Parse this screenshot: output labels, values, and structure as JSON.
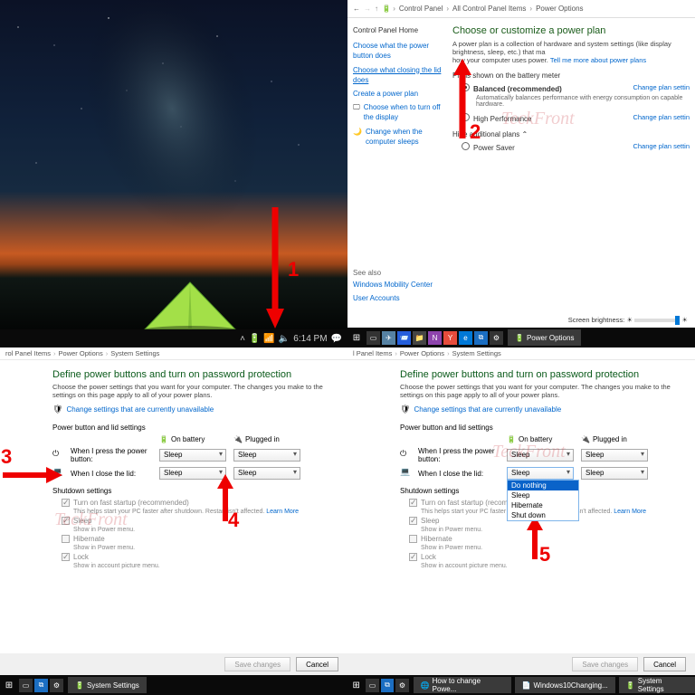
{
  "watermark": "TeckFront",
  "panel1": {
    "time": "6:14 PM",
    "arrow_label": "1"
  },
  "panel2": {
    "breadcrumb": [
      "Control Panel",
      "All Control Panel Items",
      "Power Options"
    ],
    "side_header": "Control Panel Home",
    "side_links": {
      "l1": "Choose what the power button does",
      "l2": "Choose what closing the lid does",
      "l3": "Create a power plan",
      "l4": "Choose when to turn off the display",
      "l5": "Change when the computer sleeps"
    },
    "title": "Choose or customize a power plan",
    "desc_a": "A power plan is a collection of hardware and system settings (like display brightness, sleep, etc.) that ma",
    "desc_b": "how your computer uses power. ",
    "desc_link": "Tell me more about power plans",
    "plans_label": "Plans shown on the battery meter",
    "plan_bal": "Balanced (recommended)",
    "plan_bal_sub": "Automatically balances performance with energy consumption on capable hardware.",
    "plan_hp": "High Performance",
    "hide_label": "Hide additional plans",
    "plan_ps": "Power Saver",
    "change_link": "Change plan settin",
    "seealso": "See also",
    "seealso_l1": "Windows Mobility Center",
    "seealso_l2": "User Accounts",
    "bright_label": "Screen brightness:",
    "taskbar_btn": "Power Options",
    "arrow_label": "2"
  },
  "panel3": {
    "breadcrumb": [
      "rol Panel Items",
      "Power Options",
      "System Settings"
    ],
    "title": "Define power buttons and turn on password protection",
    "desc": "Choose the power settings that you want for your computer. The changes you make to the settings on this page apply to all of your power plans.",
    "shield_link": "Change settings that are currently unavailable",
    "sec_label": "Power button and lid settings",
    "col_bat": "On battery",
    "col_plug": "Plugged in",
    "row1_label": "When I press the power button:",
    "row2_label": "When I close the lid:",
    "dd_value": "Sleep",
    "shut_label": "Shutdown settings",
    "opt_fast": "Turn on fast startup (recommended)",
    "opt_fast_sub_a": "This helps start your PC faster after shutdown. Restart isn't affected. ",
    "opt_fast_link": "Learn More",
    "opt_sleep": "Sleep",
    "opt_sleep_sub": "Show in Power menu.",
    "opt_hib": "Hibernate",
    "opt_hib_sub": "Show in Power menu.",
    "opt_lock": "Lock",
    "opt_lock_sub": "Show in account picture menu.",
    "btn_save": "Save changes",
    "btn_cancel": "Cancel",
    "taskbar_btn": "System Settings",
    "arrow3": "3",
    "arrow4": "4"
  },
  "panel4": {
    "breadcrumb": [
      "l Panel Items",
      "Power Options",
      "System Settings"
    ],
    "dd_opts": {
      "o1": "Do nothing",
      "o2": "Sleep",
      "o3": "Hibernate",
      "o4": "Shut down"
    },
    "arrow5": "5",
    "taskbar_b1": "How to change Powe...",
    "taskbar_b2": "Windows10Changing...",
    "taskbar_b3": "System Settings"
  }
}
